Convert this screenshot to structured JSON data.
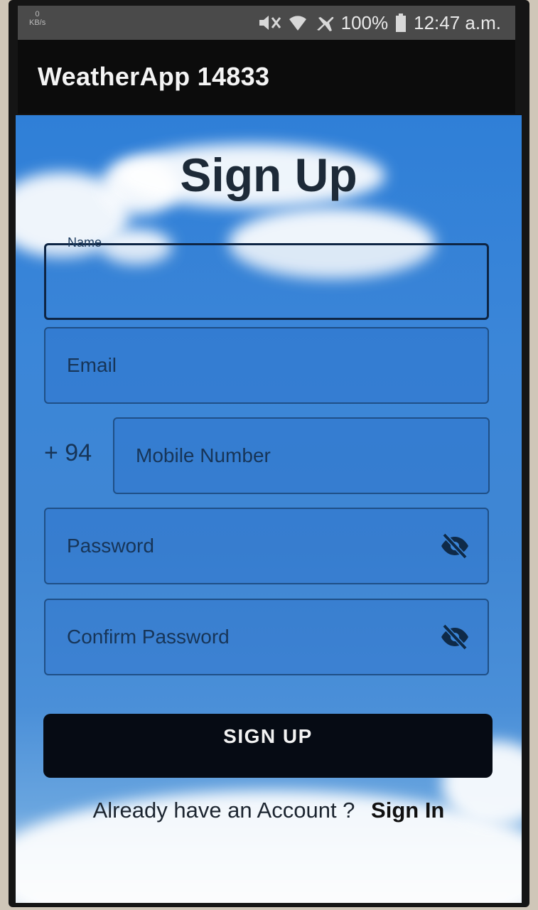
{
  "status_bar": {
    "net_speed": "0",
    "net_unit": "KB/s",
    "battery": "100%",
    "time": "12:47 a.m."
  },
  "app_bar": {
    "title": "WeatherApp 14833"
  },
  "form": {
    "title": "Sign Up",
    "name": {
      "label": "Name",
      "value": ""
    },
    "email": {
      "placeholder": "Email"
    },
    "mobile": {
      "country_code": "+ 94",
      "placeholder": "Mobile Number"
    },
    "password": {
      "placeholder": "Password",
      "icon": "eye-off-icon"
    },
    "confirm_password": {
      "placeholder": "Confirm Password",
      "icon": "eye-off-icon"
    },
    "submit_label": "SIGN UP",
    "signin_prompt": "Already have an Account ?",
    "signin_link": "Sign In"
  },
  "colors": {
    "app_bar_bg": "#0c0c0c",
    "sky_blue": "#3b86d8",
    "button_bg": "#060b14",
    "field_border": "#1f4f86"
  }
}
